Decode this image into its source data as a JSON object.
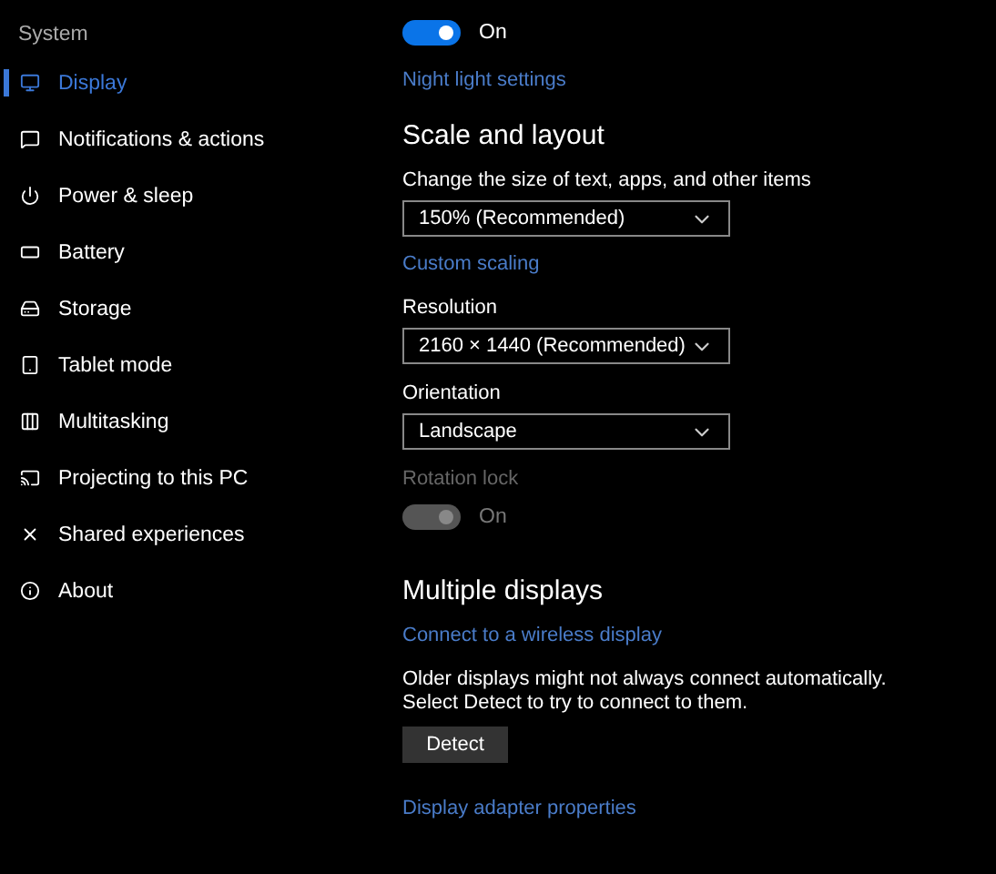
{
  "sidebar": {
    "heading": "System",
    "items": [
      {
        "label": "Display",
        "selected": true
      },
      {
        "label": "Notifications & actions",
        "selected": false
      },
      {
        "label": "Power & sleep",
        "selected": false
      },
      {
        "label": "Battery",
        "selected": false
      },
      {
        "label": "Storage",
        "selected": false
      },
      {
        "label": "Tablet mode",
        "selected": false
      },
      {
        "label": "Multitasking",
        "selected": false
      },
      {
        "label": "Projecting to this PC",
        "selected": false
      },
      {
        "label": "Shared experiences",
        "selected": false
      },
      {
        "label": "About",
        "selected": false
      }
    ]
  },
  "night_light": {
    "toggle": {
      "on": true,
      "disabled": false,
      "text": "On"
    },
    "link": "Night light settings"
  },
  "scale_and_layout": {
    "title": "Scale and layout",
    "scale_label": "Change the size of text, apps, and other items",
    "scale_value": "150% (Recommended)",
    "custom_link": "Custom scaling",
    "resolution_label": "Resolution",
    "resolution_value": "2160 × 1440 (Recommended)",
    "orientation_label": "Orientation",
    "orientation_value": "Landscape",
    "rotation_lock": {
      "label": "Rotation lock",
      "toggle": {
        "on": true,
        "disabled": true,
        "text": "On"
      }
    }
  },
  "multiple_displays": {
    "title": "Multiple displays",
    "link": "Connect to a wireless display",
    "description": "Older displays might not always connect automatically. Select Detect to try to connect to them.",
    "button": "Detect",
    "adapter_link": "Display adapter properties"
  }
}
